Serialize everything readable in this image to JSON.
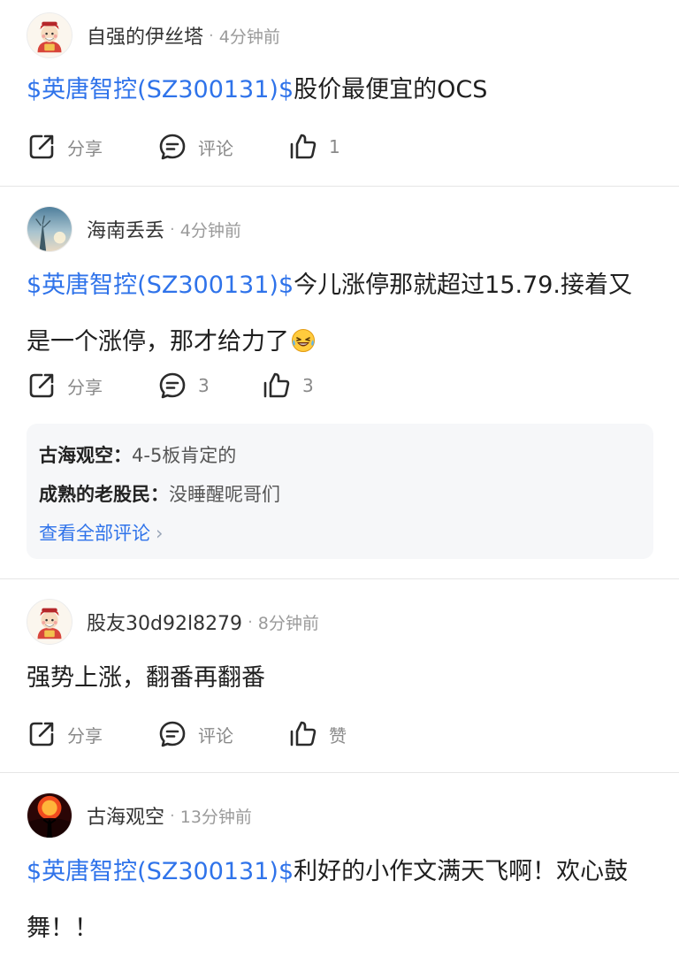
{
  "colors": {
    "stock_link": "#2f73ea",
    "divider": "#e6e6e6",
    "muted": "#9a9a9a",
    "comment_bg": "#f6f7f9"
  },
  "posts": [
    {
      "user": "自强的伊丝塔",
      "dot": "·",
      "time": "4分钟前",
      "stock": "$英唐智控(SZ300131)$",
      "text": "股价最便宜的OCS",
      "share_label": "分享",
      "comment_label": "评论",
      "like_label": "1"
    },
    {
      "user": "海南丢丢",
      "dot": "·",
      "time": "4分钟前",
      "stock": "$英唐智控(SZ300131)$",
      "text": "今儿涨停那就超过15.79.接着又是一个涨停，那才给力了",
      "emoji": "laughing-emoji",
      "share_label": "分享",
      "comment_label": "3",
      "like_label": "3",
      "comments": [
        {
          "author": "古海观空：",
          "text": "4-5板肯定的"
        },
        {
          "author": "成熟的老股民：",
          "text": "没睡醒呢哥们"
        }
      ],
      "view_all": "查看全部评论",
      "chevron": "›"
    },
    {
      "user": "股友30d92l8279",
      "dot": "·",
      "time": "8分钟前",
      "text": "强势上涨，翻番再翻番",
      "share_label": "分享",
      "comment_label": "评论",
      "like_label": "赞"
    },
    {
      "user": "古海观空",
      "dot": "·",
      "time": "13分钟前",
      "stock": "$英唐智控(SZ300131)$",
      "text": "利好的小作文满天飞啊！欢心鼓舞！！"
    }
  ]
}
